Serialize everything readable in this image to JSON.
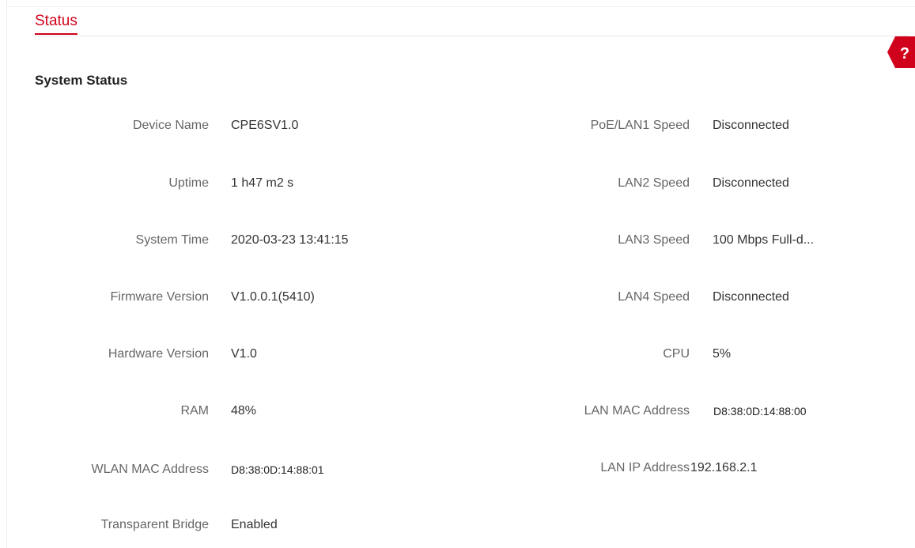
{
  "page": {
    "tab_title": "Status",
    "help_icon_label": "?",
    "help_icon": "question-mark-icon",
    "accent_color": "#d0021b"
  },
  "system_status": {
    "title": "System Status",
    "left": [
      {
        "label": "Device Name",
        "value": "CPE6SV1.0"
      },
      {
        "label": "Uptime",
        "value": "1 h47 m2 s"
      },
      {
        "label": "System Time",
        "value": "2020-03-23 13:41:15"
      },
      {
        "label": "Firmware Version",
        "value": "V1.0.0.1(5410)"
      },
      {
        "label": "Hardware Version",
        "value": "V1.0"
      },
      {
        "label": "RAM",
        "value": "48%"
      },
      {
        "label": "WLAN MAC Address",
        "value": "D8:38:0D:14:88:01"
      },
      {
        "label": "Transparent Bridge",
        "value": "Enabled"
      }
    ],
    "right": [
      {
        "label": "PoE/LAN1 Speed",
        "value": "Disconnected"
      },
      {
        "label": "LAN2 Speed",
        "value": "Disconnected"
      },
      {
        "label": "LAN3 Speed",
        "value": "100 Mbps Full-d..."
      },
      {
        "label": "LAN4 Speed",
        "value": "Disconnected"
      },
      {
        "label": "CPU",
        "value": "5%"
      },
      {
        "label": "LAN MAC Address",
        "value": "D8:38:0D:14:88:00"
      },
      {
        "label": "LAN IP Address",
        "value": "192.168.2.1"
      }
    ]
  }
}
